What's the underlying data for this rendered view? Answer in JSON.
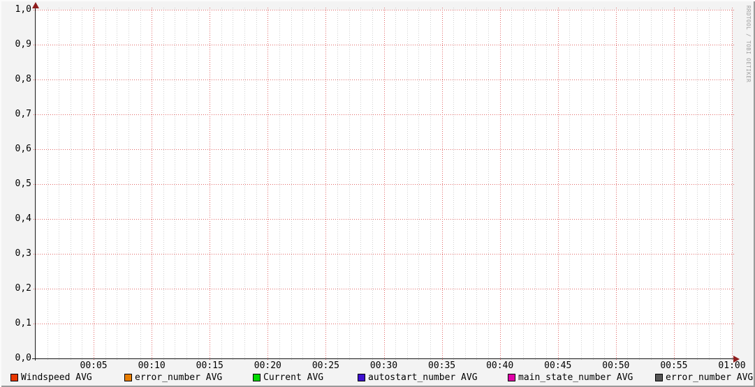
{
  "watermark": "RRDTOOL / TOBI OETIKER",
  "chart_data": {
    "type": "line",
    "title": "",
    "xlabel": "",
    "ylabel": "",
    "x_range": [
      "00:00",
      "01:00"
    ],
    "x_major_step_minutes": 5,
    "x_minor_step_minutes": 1,
    "x_tick_labels": [
      "00:05",
      "00:10",
      "00:15",
      "00:20",
      "00:25",
      "00:30",
      "00:35",
      "00:40",
      "00:45",
      "00:50",
      "00:55",
      "01:00"
    ],
    "ylim": [
      0.0,
      1.0
    ],
    "y_major_step": 0.1,
    "decimal_separator": ",",
    "y_tick_labels": [
      "1,0",
      "0,9",
      "0,8",
      "0,7",
      "0,6",
      "0,5",
      "0,4",
      "0,3",
      "0,2",
      "0,1",
      "0,0"
    ],
    "grid": {
      "style": "dotted",
      "major_color": "#e26868",
      "minor_color": "#cfcfcf",
      "canvas_color": "#ffffff",
      "background_color": "#f3f3f3"
    },
    "axis_color": "#181818",
    "arrow_color": "#8f1d1d",
    "legend_position": "bottom",
    "series": [
      {
        "name": "Windspeed",
        "legend_label": "Windspeed AVG",
        "color": "#e83700",
        "values": []
      },
      {
        "name": "error_number",
        "legend_label": "error_number AVG",
        "color": "#e87d00",
        "values": []
      },
      {
        "name": "Current",
        "legend_label": "Current AVG",
        "color": "#00d900",
        "values": []
      },
      {
        "name": "autostart_number",
        "legend_label": "autostart_number AVG",
        "color": "#3e10d0",
        "values": []
      },
      {
        "name": "main_state_number",
        "legend_label": "main_state_number AVG",
        "color": "#e000a8",
        "values": []
      },
      {
        "name": "error_number",
        "legend_label": "error_number AVG",
        "color": "#555555",
        "values": []
      }
    ]
  }
}
